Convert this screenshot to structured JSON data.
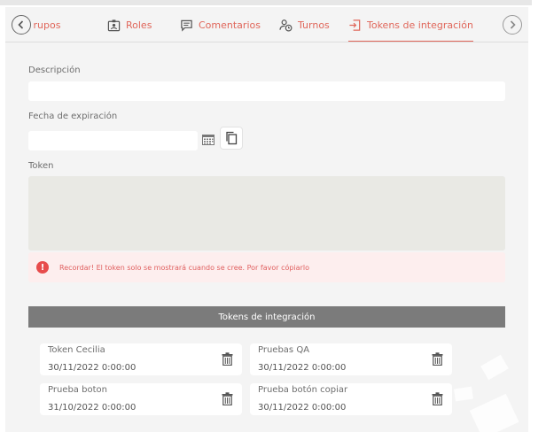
{
  "tabs": [
    {
      "label": "Grupos",
      "icon": "group-icon",
      "active": false
    },
    {
      "label": "Roles",
      "icon": "id-badge-icon",
      "active": false
    },
    {
      "label": "Comentarios",
      "icon": "comment-icon",
      "active": false
    },
    {
      "label": "Turnos",
      "icon": "user-clock-icon",
      "active": false
    },
    {
      "label": "Tokens de integración",
      "icon": "sign-in-icon",
      "active": true
    }
  ],
  "form": {
    "descripcion_label": "Descripción",
    "descripcion_value": "",
    "fecha_label": "Fecha de expiración",
    "fecha_value": "",
    "token_label": "Token",
    "token_value": ""
  },
  "alert": {
    "text": "Recordar! El token solo se mostrará cuando se cree. Por favor cópiarlo"
  },
  "section": {
    "title": "Tokens de integración"
  },
  "tokens": [
    {
      "name": "Token Cecilia",
      "date": "30/11/2022 0:00:00"
    },
    {
      "name": "Pruebas QA",
      "date": "30/11/2022 0:00:00"
    },
    {
      "name": "Prueba boton",
      "date": "31/10/2022 0:00:00"
    },
    {
      "name": "Prueba botón copiar",
      "date": "30/11/2022 0:00:00"
    }
  ],
  "colors": {
    "accent": "#e0665a",
    "alert_bg": "#fdeeee",
    "alert_icon": "#e74c4c",
    "header_bg": "#7b7b7b"
  }
}
